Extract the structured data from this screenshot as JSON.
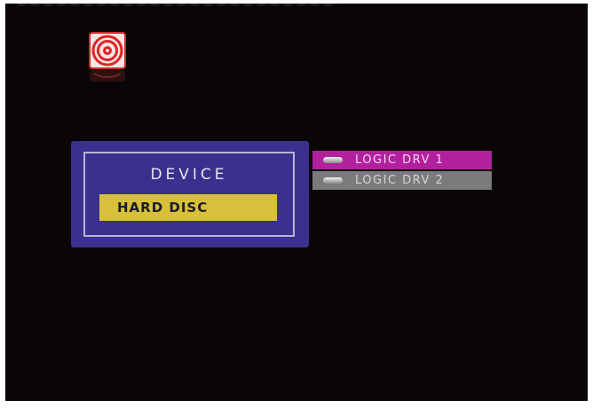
{
  "device_panel": {
    "title": "DEVICE",
    "selected_device": "HARD DISC"
  },
  "drives": {
    "items": [
      {
        "label": "LOGIC DRV 1",
        "selected": true
      },
      {
        "label": "LOGIC DRV 2",
        "selected": false
      }
    ]
  },
  "colors": {
    "screen_background": "#0a0607",
    "device_panel": "#3b2f8f",
    "device_value_highlight": "#d8c03a",
    "drive_selected": "#b2209e",
    "drive_normal": "#7b7b7b"
  },
  "icons": {
    "app_logo": "red-circular-disc-logo-icon",
    "drive_item": "drive-pill-icon"
  }
}
